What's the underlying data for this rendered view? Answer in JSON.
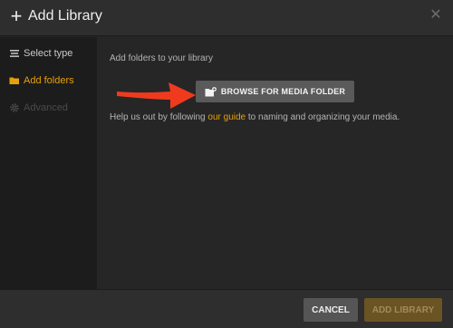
{
  "header": {
    "title": "Add Library"
  },
  "sidebar": {
    "items": [
      {
        "label": "Select type"
      },
      {
        "label": "Add folders"
      },
      {
        "label": "Advanced"
      }
    ]
  },
  "main": {
    "subtitle": "Add folders to your library",
    "browse_label": "BROWSE FOR MEDIA FOLDER",
    "help_prefix": "Help us out by following ",
    "help_link": "our guide",
    "help_suffix": " to naming and organizing your media."
  },
  "footer": {
    "cancel_label": "CANCEL",
    "add_label": "ADD LIBRARY"
  },
  "colors": {
    "accent": "#e5a00d",
    "arrow": "#f03a1e"
  }
}
